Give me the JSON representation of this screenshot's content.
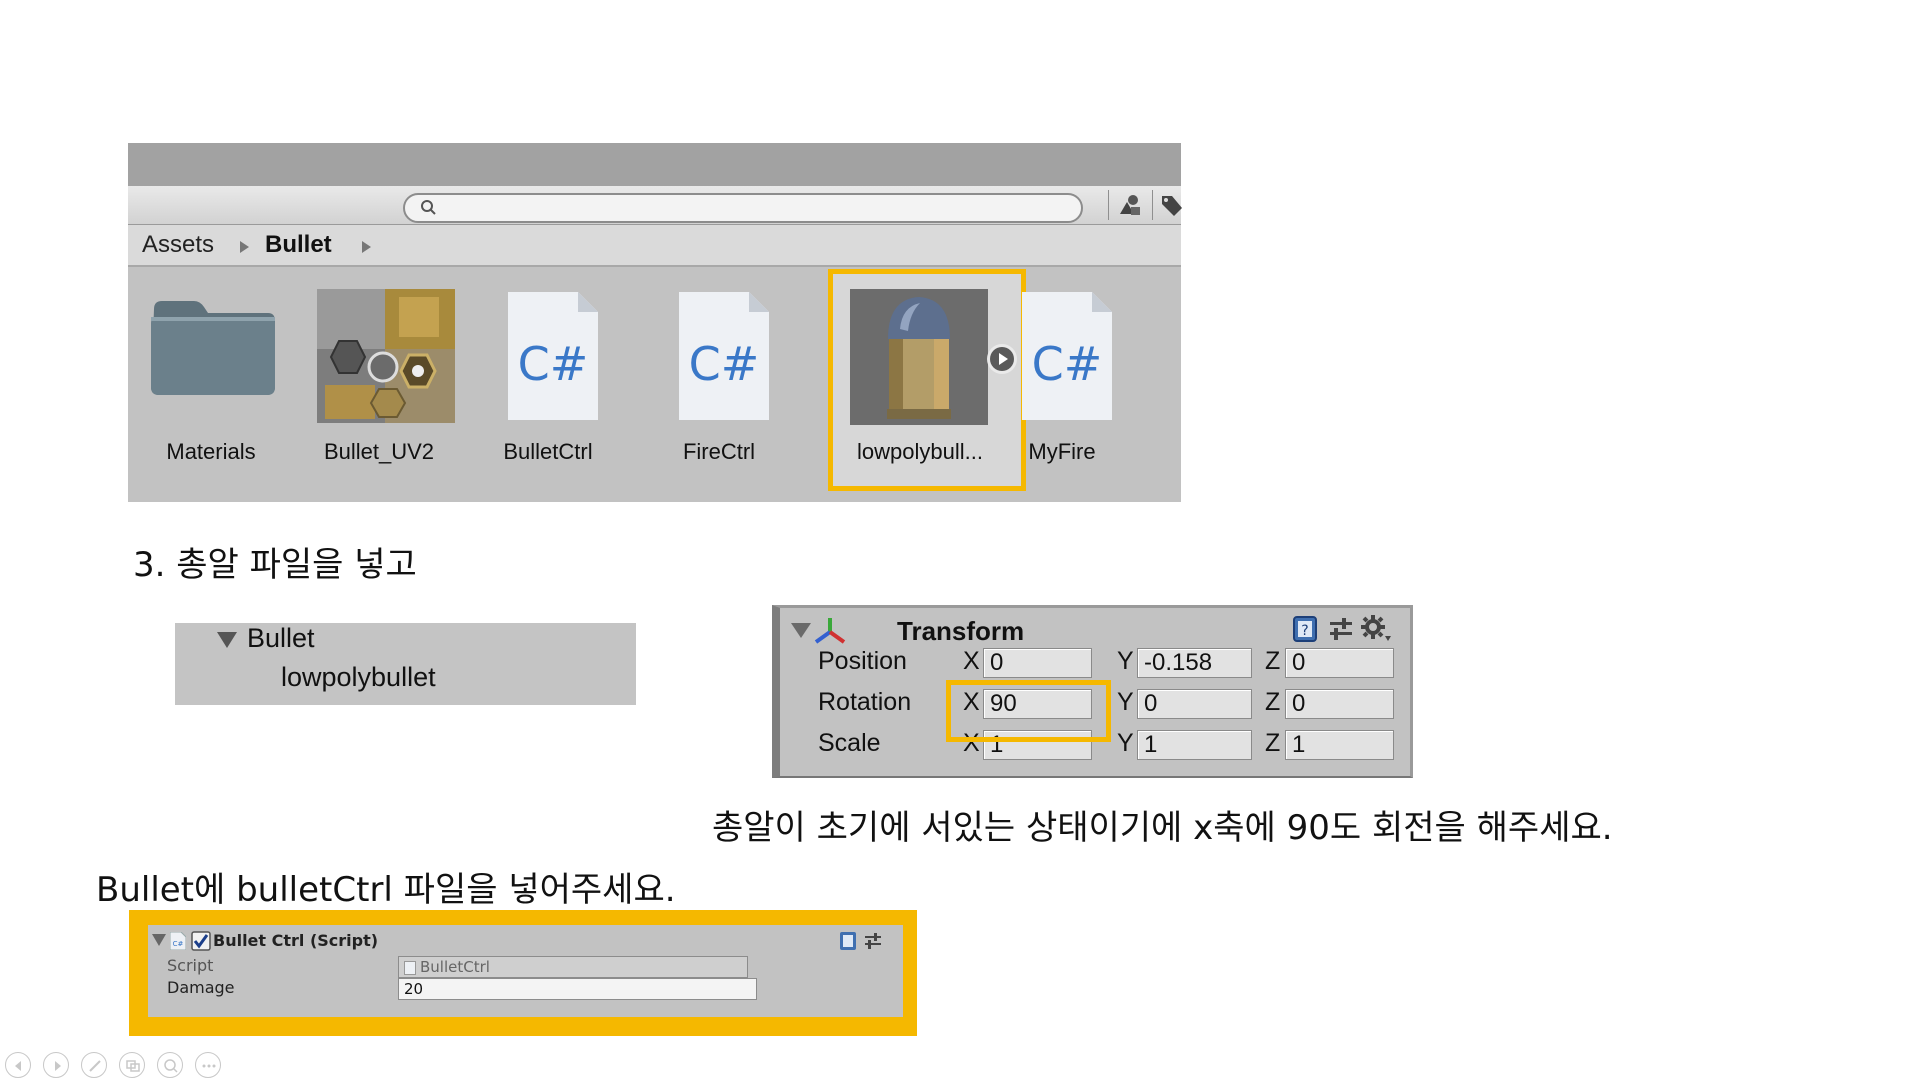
{
  "project_browser": {
    "search": {
      "value": ""
    },
    "breadcrumb": [
      "Assets",
      "Bullet"
    ],
    "assets": [
      {
        "label": "Materials",
        "kind": "folder"
      },
      {
        "label": "Bullet_UV2",
        "kind": "texture"
      },
      {
        "label": "BulletCtrl",
        "kind": "script",
        "icon_text": "C#"
      },
      {
        "label": "FireCtrl",
        "kind": "script",
        "icon_text": "C#"
      },
      {
        "label": "lowpolybull...",
        "kind": "model",
        "selected": true
      },
      {
        "label": "MyFire",
        "kind": "script",
        "icon_text": "C#"
      }
    ],
    "highlight_color": "#f5b800"
  },
  "slide": {
    "step3": "3. 총알 파일을 넣고",
    "rotate_note": "총알이 초기에 서있는 상태이기에 x축에 90도 회전을 해주세요.",
    "attach_note": "Bullet에 bulletCtrl 파일을 넣어주세요."
  },
  "hierarchy": {
    "parent": "Bullet",
    "child": "lowpolybullet"
  },
  "transform": {
    "title": "Transform",
    "rows": [
      {
        "label": "Position",
        "x": "0",
        "y": "-0.158",
        "z": "0"
      },
      {
        "label": "Rotation",
        "x": "90",
        "y": "0",
        "z": "0"
      },
      {
        "label": "Scale",
        "x": "1",
        "y": "1",
        "z": "1"
      }
    ],
    "axes": [
      "X",
      "Y",
      "Z"
    ]
  },
  "bullet_ctrl": {
    "title": "Bullet Ctrl (Script)",
    "enabled": true,
    "icon_text": "C#",
    "fields": [
      {
        "label": "Script",
        "value": "BulletCtrl"
      },
      {
        "label": "Damage",
        "value": "20"
      }
    ]
  },
  "slideshow_nav": [
    "prev",
    "next",
    "pen",
    "slides",
    "zoom",
    "more"
  ]
}
